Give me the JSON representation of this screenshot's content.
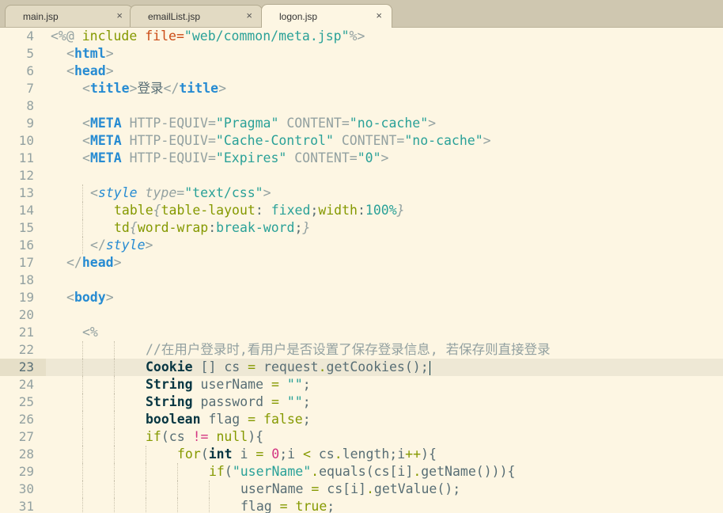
{
  "tabs": [
    {
      "label": "main.jsp",
      "active": false
    },
    {
      "label": "emailList.jsp",
      "active": false
    },
    {
      "label": "logon.jsp",
      "active": true
    }
  ],
  "close_glyph": "×",
  "line_numbers": [
    "4",
    "5",
    "6",
    "7",
    "8",
    "9",
    "10",
    "11",
    "12",
    "13",
    "14",
    "15",
    "16",
    "17",
    "18",
    "19",
    "20",
    "21",
    "22",
    "23",
    "24",
    "25",
    "26",
    "27",
    "28",
    "29",
    "30",
    "31"
  ],
  "current_line": "23",
  "code": {
    "l4": [
      "<%@ ",
      "include",
      " ",
      "file=",
      "\"web/common/meta.jsp\"",
      "%>"
    ],
    "l5": [
      "<",
      "html",
      ">"
    ],
    "l6": [
      "<",
      "head",
      ">"
    ],
    "l7": [
      "<",
      "title",
      ">",
      "登录",
      "</",
      "title",
      ">"
    ],
    "l9": [
      "<",
      "META",
      " HTTP-EQUIV=",
      "\"Pragma\"",
      " CONTENT=",
      "\"no-cache\"",
      ">"
    ],
    "l10": [
      "<",
      "META",
      " HTTP-EQUIV=",
      "\"Cache-Control\"",
      " CONTENT=",
      "\"no-cache\"",
      ">"
    ],
    "l11": [
      "<",
      "META",
      " HTTP-EQUIV=",
      "\"Expires\"",
      " CONTENT=",
      "\"0\"",
      ">"
    ],
    "l13": [
      "<",
      "style",
      " ",
      "type",
      "=",
      "\"text/css\"",
      ">"
    ],
    "l14": [
      "table",
      "{",
      "table-layout",
      ": ",
      "fixed",
      ";",
      "width",
      ":",
      "100%",
      "}"
    ],
    "l15": [
      "td",
      "{",
      "word-wrap",
      ":",
      "break-word",
      ";",
      "}"
    ],
    "l16": [
      "</",
      "style",
      ">"
    ],
    "l17": [
      "</",
      "head",
      ">"
    ],
    "l19": [
      "<",
      "body",
      ">"
    ],
    "l21": [
      "<%"
    ],
    "l22": [
      "//在用户登录时,看用户是否设置了保存登录信息, 若保存则直接登录"
    ],
    "l23": [
      "Cookie",
      " [] cs ",
      "=",
      " request",
      ".",
      "getCookies();"
    ],
    "l24": [
      "String",
      " userName ",
      "=",
      " ",
      "\"\"",
      ";"
    ],
    "l25": [
      "String",
      " password ",
      "=",
      " ",
      "\"\"",
      ";"
    ],
    "l26": [
      "boolean",
      " flag ",
      "=",
      " ",
      "false",
      ";"
    ],
    "l27": [
      "if",
      "(cs ",
      "!=",
      " ",
      "null",
      "){"
    ],
    "l28": [
      "for",
      "(",
      "int",
      " i ",
      "=",
      " ",
      "0",
      ";i ",
      "<",
      " cs",
      ".",
      "length;i",
      "++",
      "){"
    ],
    "l29": [
      "if",
      "(",
      "\"userName\"",
      ".",
      "equals(cs[i]",
      ".",
      "getName())){"
    ],
    "l30": [
      "userName ",
      "=",
      " cs[i]",
      ".",
      "getValue();"
    ],
    "l31": [
      "flag ",
      "=",
      " ",
      "true",
      ";"
    ]
  }
}
